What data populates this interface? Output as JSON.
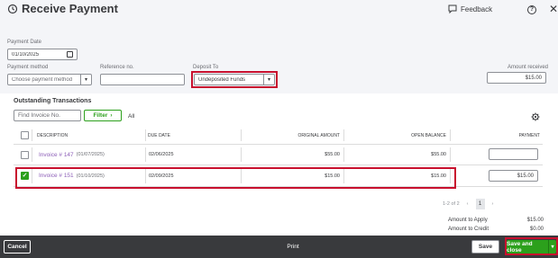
{
  "header": {
    "title": "Receive Payment",
    "feedback_label": "Feedback",
    "help_label": "?",
    "close_label": "✕"
  },
  "form": {
    "payment_date_label": "Payment Date",
    "payment_date_value": "01/10/2025",
    "payment_method_label": "Payment method",
    "payment_method_placeholder": "Choose payment method",
    "reference_label": "Reference no.",
    "reference_value": "",
    "deposit_to_label": "Deposit To",
    "deposit_to_value": "Undeposited Funds",
    "amount_received_label": "Amount received",
    "amount_received_value": "$15.00"
  },
  "outstanding": {
    "title": "Outstanding Transactions",
    "find_placeholder": "Find Invoice No.",
    "filter_label": "Filter",
    "all_label": "All",
    "columns": {
      "description": "DESCRIPTION",
      "due_date": "DUE DATE",
      "original_amount": "ORIGINAL AMOUNT",
      "open_balance": "OPEN BALANCE",
      "payment": "PAYMENT"
    },
    "rows": [
      {
        "checked": false,
        "invoice": "Invoice # 147",
        "invoice_date": "(01/07/2025)",
        "due_date": "02/06/2025",
        "original_amount": "$55.00",
        "open_balance": "$55.00",
        "payment": ""
      },
      {
        "checked": true,
        "invoice": "Invoice # 151",
        "invoice_date": "(01/10/2025)",
        "due_date": "02/09/2025",
        "original_amount": "$15.00",
        "open_balance": "$15.00",
        "payment": "$15.00"
      }
    ],
    "pagination": {
      "range": "1-2 of 2",
      "current_page": "1"
    }
  },
  "totals": {
    "amount_to_apply_label": "Amount to Apply",
    "amount_to_apply_value": "$15.00",
    "amount_to_credit_label": "Amount to Credit",
    "amount_to_credit_value": "$0.00"
  },
  "footer": {
    "cancel_label": "Cancel",
    "print_label": "Print",
    "save_label": "Save",
    "save_close_label": "Save and close"
  },
  "colors": {
    "accent_green": "#2ca01c",
    "highlight_red": "#c8102e",
    "link_purple": "#8d5fb8",
    "footer_bg": "#393a3d"
  }
}
